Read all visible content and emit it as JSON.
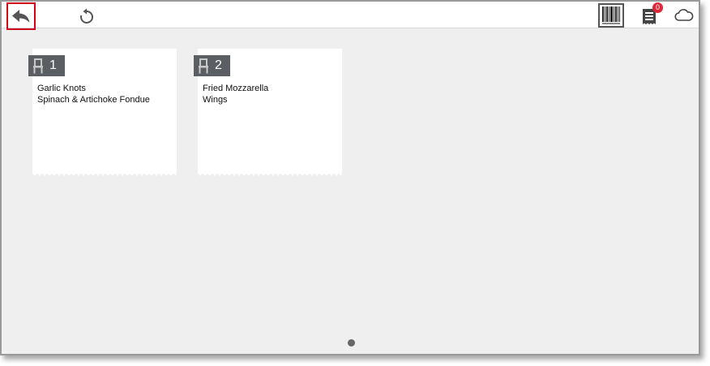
{
  "toolbar": {
    "back_icon": "back-arrow-icon",
    "undo_icon": "undo-icon",
    "barcode_icon": "barcode-icon",
    "receipt_icon": "receipt-icon",
    "receipt_badge": "0",
    "cloud_icon": "cloud-icon",
    "highlight_color": "#d0021b",
    "badge_color": "#e0273a"
  },
  "seats": [
    {
      "number": "1",
      "items": [
        "Garlic Knots",
        "Spinach & Artichoke Fondue"
      ]
    },
    {
      "number": "2",
      "items": [
        "Fried Mozzarella",
        "Wings"
      ]
    }
  ],
  "pager": {
    "current_page": 1,
    "total_pages": 1
  }
}
